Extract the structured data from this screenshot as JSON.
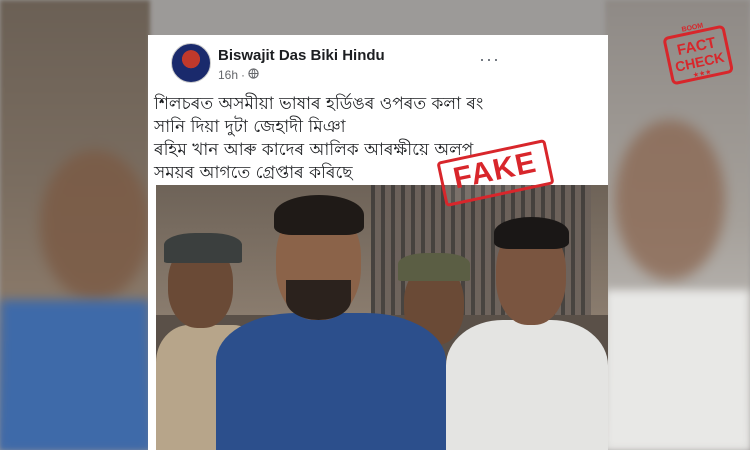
{
  "post": {
    "author": "Biswajit Das Biki Hindu",
    "time": "16h",
    "separator": "·",
    "more": "···",
    "text_lines": [
      "শিলচৰত অসমীয়া ভাষাৰ হৰ্ডিঙৰ ওপৰত কলা ৰং",
      "সানি দিয়া দুটা জেহাদী মিঞা",
      "ৰহিম খান আৰু কাদেৰ আলিক আৰক্ষীয়ে অলপ",
      "সময়ৰ আগতে গ্ৰেপ্তাৰ কৰিছে"
    ]
  },
  "stamp": {
    "label": "FAKE",
    "color": "#d8262b"
  },
  "logo": {
    "top": "BOOM",
    "line1": "FACT",
    "line2": "CHECK",
    "stars": "★★★",
    "color": "#d8262b"
  },
  "icons": {
    "privacy": "globe-icon",
    "more": "more-dots-icon"
  }
}
